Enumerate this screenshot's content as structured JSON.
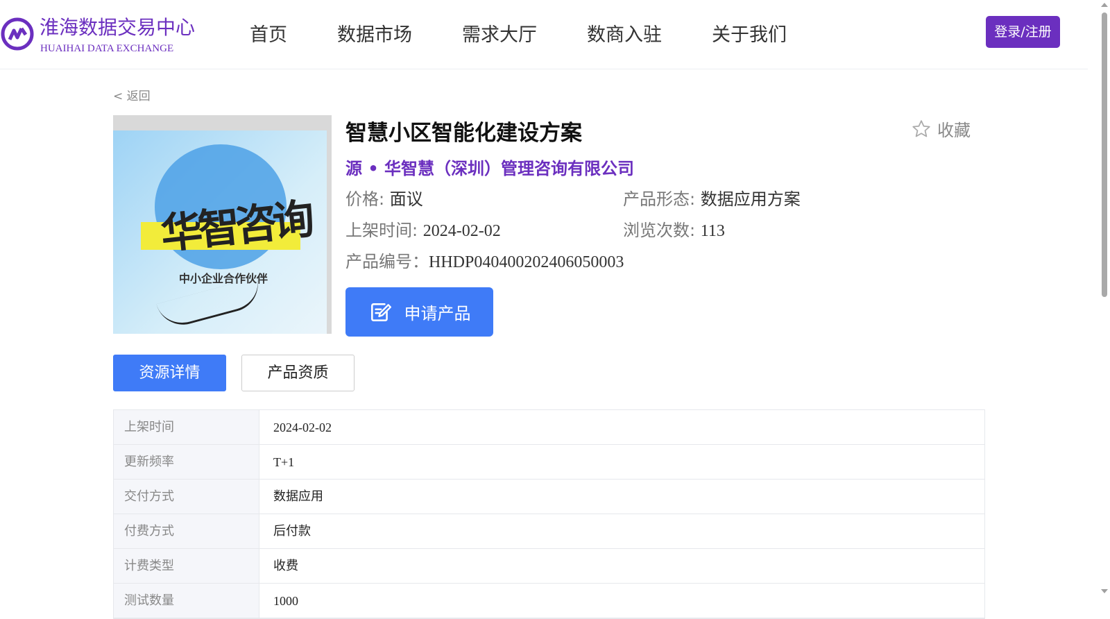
{
  "brand": {
    "name_cn": "淮海数据交易中心",
    "name_en": "HUAIHAI DATA EXCHANGE",
    "color": "#6b2fbf"
  },
  "nav": {
    "items": [
      "首页",
      "数据市场",
      "需求大厅",
      "数商入驻",
      "关于我们"
    ],
    "login_label": "登录/注册"
  },
  "back_label": "< 返回",
  "product": {
    "image_text_large": "华智咨询",
    "image_text_small": "中小企业合作伙伴",
    "title": "智慧小区智能化建设方案",
    "favorite_label": "收藏",
    "source": "源 • 华智慧（深圳）管理咨询有限公司",
    "price_label": "价格:",
    "price_value": "面议",
    "form_label": "产品形态:",
    "form_value": "数据应用方案",
    "listed_label": "上架时间:",
    "listed_value": "2024-02-02",
    "views_label": "浏览次数:",
    "views_value": "113",
    "code_label": "产品编号：",
    "code_value": "HHDP040400202406050003",
    "apply_label": "申请产品"
  },
  "tabs": {
    "active": "资源详情",
    "inactive": "产品资质"
  },
  "details": [
    {
      "key": "上架时间",
      "value": "2024-02-02"
    },
    {
      "key": "更新频率",
      "value": "T+1"
    },
    {
      "key": "交付方式",
      "value": "数据应用"
    },
    {
      "key": "付费方式",
      "value": "后付款"
    },
    {
      "key": "计费类型",
      "value": "收费"
    },
    {
      "key": "测试数量",
      "value": "1000"
    }
  ],
  "accent_color": "#3f7bf7"
}
